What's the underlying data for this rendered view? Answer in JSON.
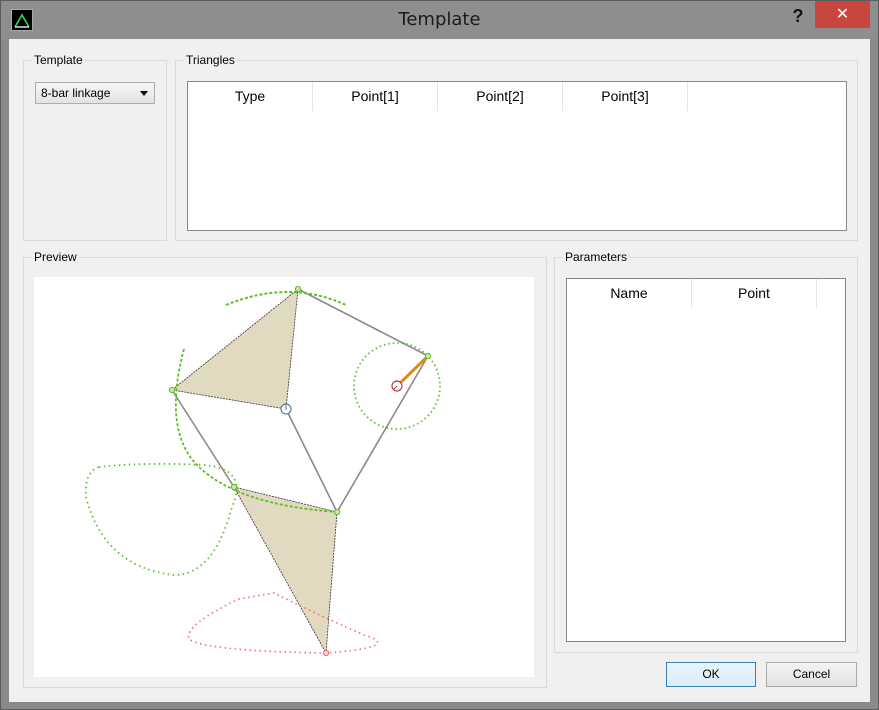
{
  "window": {
    "title": "Template",
    "help_label": "?",
    "close_label": "✕"
  },
  "template_group": {
    "title": "Template",
    "select_value": "8-bar linkage"
  },
  "triangles_group": {
    "title": "Triangles",
    "columns": [
      "Type",
      "Point[1]",
      "Point[2]",
      "Point[3]"
    ]
  },
  "preview_group": {
    "title": "Preview"
  },
  "parameters_group": {
    "title": "Parameters",
    "columns": [
      "Name",
      "Point"
    ]
  },
  "buttons": {
    "ok": "OK",
    "cancel": "Cancel"
  },
  "colors": {
    "triangle_fill": "#e1d9c0",
    "path_green": "#5cbf2a",
    "path_red": "#f26d6d",
    "crank_orange": "#e08a1e",
    "link_gray": "#8a8a8a"
  }
}
